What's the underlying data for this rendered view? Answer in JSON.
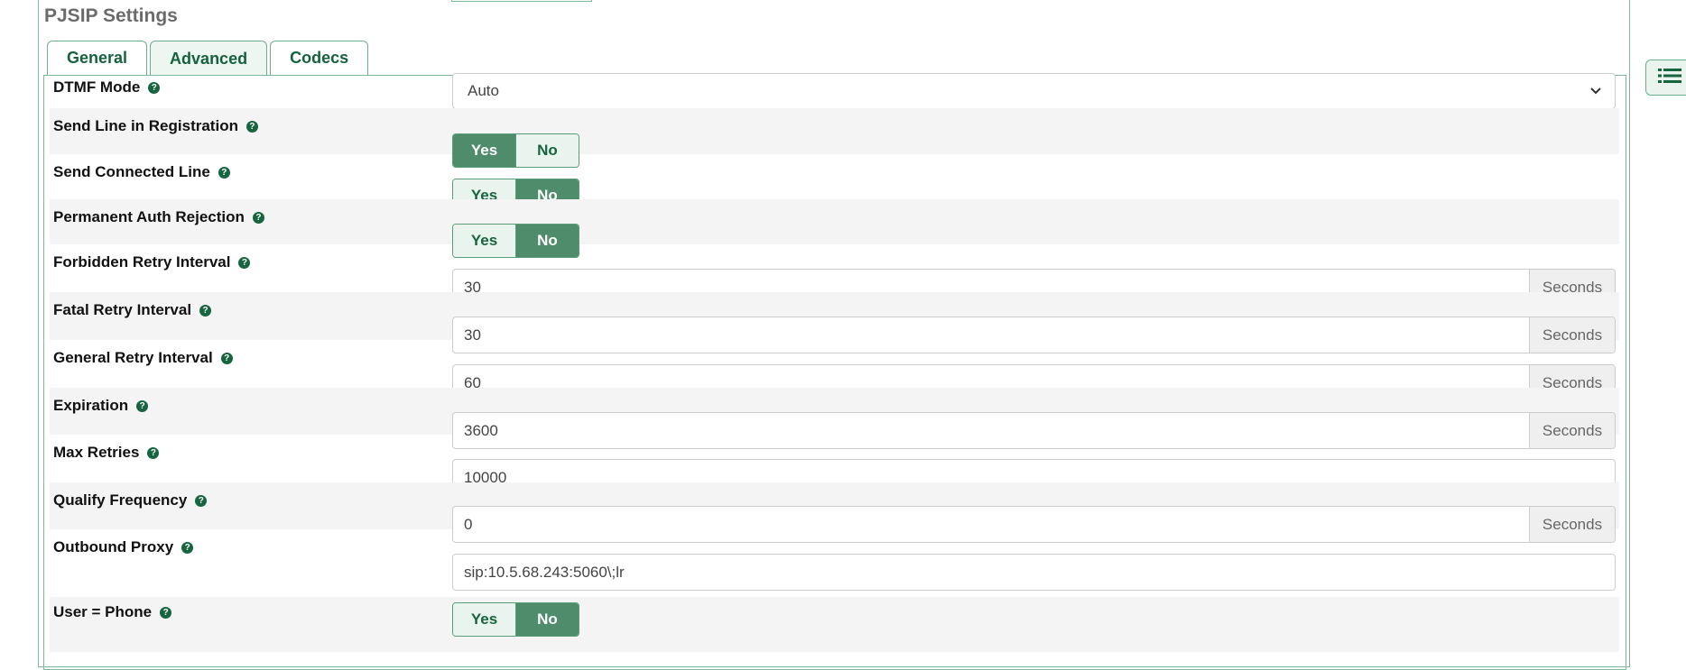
{
  "section_title": "PJSIP Settings",
  "tabs": [
    {
      "label": "General",
      "active": false
    },
    {
      "label": "Advanced",
      "active": true
    },
    {
      "label": "Codecs",
      "active": false
    }
  ],
  "colors": {
    "accent": "#16653f",
    "toggle_on": "#4e8c6c",
    "toggle_off": "#eaf4ee",
    "border": "#7fb79b"
  },
  "fields": {
    "dtmf_mode": {
      "label": "DTMF Mode",
      "value": "Auto"
    },
    "send_line": {
      "label": "Send Line in Registration",
      "yes": "Yes",
      "no": "No",
      "selected": "Yes"
    },
    "send_connected": {
      "label": "Send Connected Line",
      "yes": "Yes",
      "no": "No",
      "selected": "No"
    },
    "perm_auth": {
      "label": "Permanent Auth Rejection",
      "yes": "Yes",
      "no": "No",
      "selected": "No"
    },
    "forbidden_retry": {
      "label": "Forbidden Retry Interval",
      "value": "30",
      "unit": "Seconds"
    },
    "fatal_retry": {
      "label": "Fatal Retry Interval",
      "value": "30",
      "unit": "Seconds"
    },
    "general_retry": {
      "label": "General Retry Interval",
      "value": "60",
      "unit": "Seconds"
    },
    "expiration": {
      "label": "Expiration",
      "value": "3600",
      "unit": "Seconds"
    },
    "max_retries": {
      "label": "Max Retries",
      "value": "10000"
    },
    "qualify_freq": {
      "label": "Qualify Frequency",
      "value": "0",
      "unit": "Seconds"
    },
    "outbound_proxy": {
      "label": "Outbound Proxy",
      "value": "sip:10.5.68.243:5060\\;lr"
    },
    "user_phone": {
      "label": "User = Phone",
      "yes": "Yes",
      "no": "No",
      "selected": "No"
    }
  },
  "icons": {
    "help": "question-circle-icon",
    "side_menu": "list-icon",
    "select_arrow": "chevron-down-icon"
  }
}
